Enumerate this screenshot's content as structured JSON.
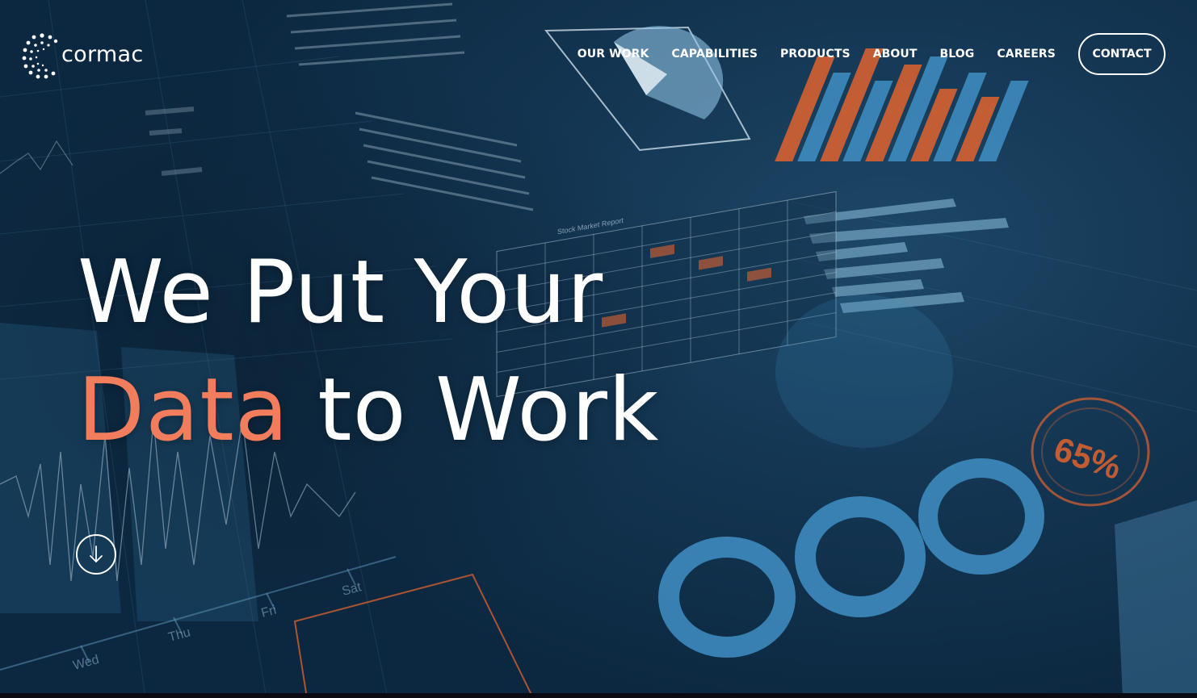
{
  "brand": {
    "name": "cormac"
  },
  "nav": {
    "items": [
      {
        "label": "OUR WORK"
      },
      {
        "label": "CAPABILITIES"
      },
      {
        "label": "PRODUCTS"
      },
      {
        "label": "ABOUT"
      },
      {
        "label": "BLOG"
      },
      {
        "label": "CAREERS"
      }
    ],
    "contact_label": "CONTACT"
  },
  "hero": {
    "line1": "We Put Your",
    "accent_word": "Data",
    "line2_rest": "to Work",
    "scroll_icon": "arrow-down-icon"
  },
  "background": {
    "percent_label": "65%",
    "report_title": "Stock Market Report",
    "day_labels": [
      "Wed",
      "Thu",
      "Fri",
      "Sat"
    ]
  },
  "colors": {
    "accent": "#f27d5c",
    "text": "#ffffff",
    "background": "#0c2840",
    "chart_blue": "#3f8fc4",
    "chart_orange": "#e0632e"
  }
}
